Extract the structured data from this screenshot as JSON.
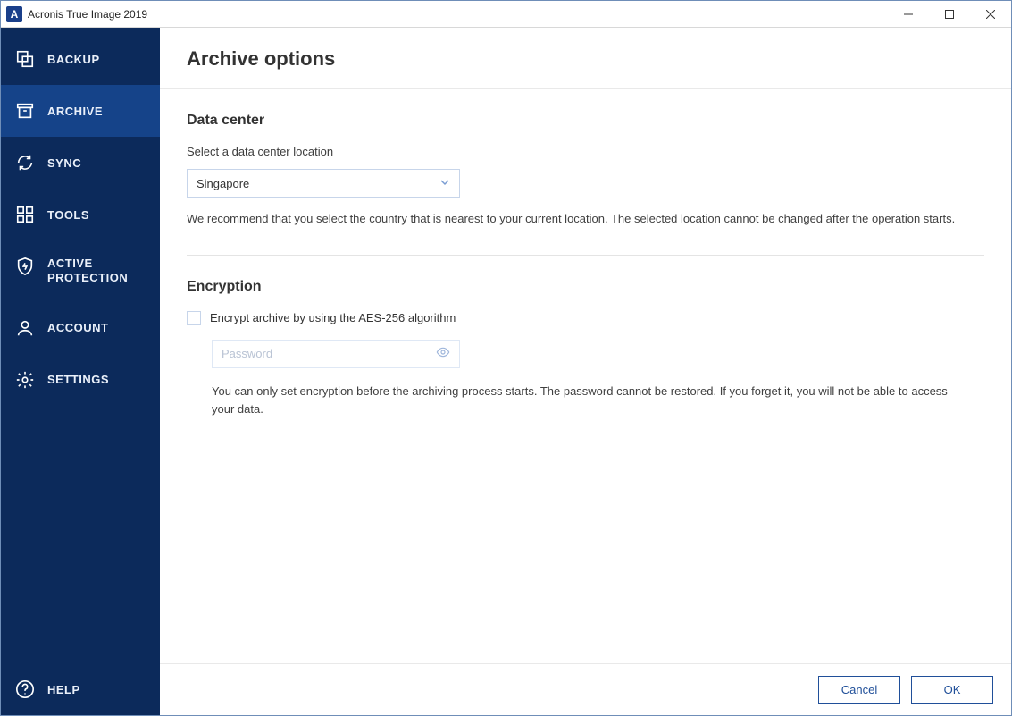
{
  "window": {
    "title": "Acronis True Image 2019",
    "app_initial": "A"
  },
  "sidebar": {
    "items": [
      {
        "key": "backup",
        "label": "BACKUP"
      },
      {
        "key": "archive",
        "label": "ARCHIVE"
      },
      {
        "key": "sync",
        "label": "SYNC"
      },
      {
        "key": "tools",
        "label": "TOOLS"
      },
      {
        "key": "active_protection",
        "label": "ACTIVE\nPROTECTION"
      },
      {
        "key": "account",
        "label": "ACCOUNT"
      },
      {
        "key": "settings",
        "label": "SETTINGS"
      }
    ],
    "help_label": "HELP",
    "active_key": "archive"
  },
  "page": {
    "title": "Archive options",
    "data_center": {
      "heading": "Data center",
      "select_label": "Select a data center location",
      "selected": "Singapore",
      "recommend": "We recommend that you select the country that is nearest to your current location. The selected location cannot be changed after the operation starts."
    },
    "encryption": {
      "heading": "Encryption",
      "checkbox_label": "Encrypt archive by using the AES-256 algorithm",
      "checked": false,
      "password_placeholder": "Password",
      "note": "You can only set encryption before the archiving process starts. The password cannot be restored. If you forget it, you will not be able to access your data."
    },
    "buttons": {
      "cancel": "Cancel",
      "ok": "OK"
    }
  }
}
